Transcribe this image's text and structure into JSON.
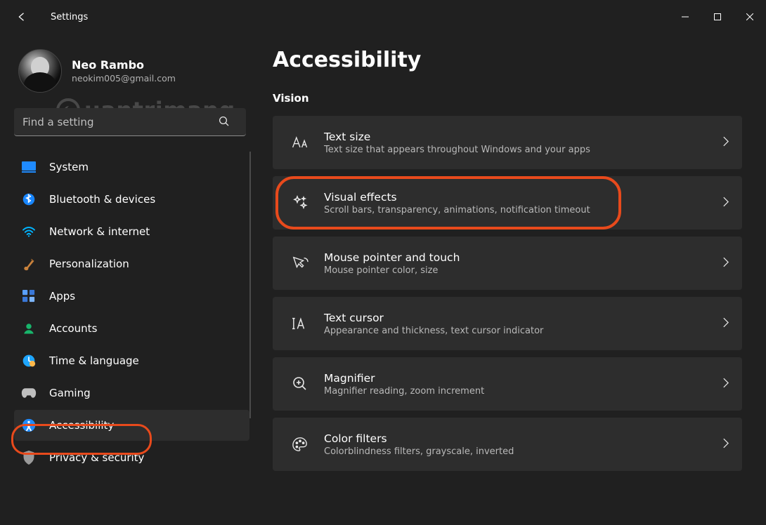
{
  "titlebar": {
    "title": "Settings"
  },
  "user": {
    "name": "Neo Rambo",
    "email": "neokim005@gmail.com"
  },
  "watermark": {
    "text": "uantrimang"
  },
  "search": {
    "placeholder": "Find a setting"
  },
  "nav": {
    "items": [
      {
        "label": "System"
      },
      {
        "label": "Bluetooth & devices"
      },
      {
        "label": "Network & internet"
      },
      {
        "label": "Personalization"
      },
      {
        "label": "Apps"
      },
      {
        "label": "Accounts"
      },
      {
        "label": "Time & language"
      },
      {
        "label": "Gaming"
      },
      {
        "label": "Accessibility"
      },
      {
        "label": "Privacy & security"
      }
    ],
    "active_index": 8
  },
  "page": {
    "title": "Accessibility",
    "section": "Vision",
    "items": [
      {
        "title": "Text size",
        "desc": "Text size that appears throughout Windows and your apps"
      },
      {
        "title": "Visual effects",
        "desc": "Scroll bars, transparency, animations, notification timeout"
      },
      {
        "title": "Mouse pointer and touch",
        "desc": "Mouse pointer color, size"
      },
      {
        "title": "Text cursor",
        "desc": "Appearance and thickness, text cursor indicator"
      },
      {
        "title": "Magnifier",
        "desc": "Magnifier reading, zoom increment"
      },
      {
        "title": "Color filters",
        "desc": "Colorblindness filters, grayscale, inverted"
      }
    ],
    "highlighted_index": 1
  },
  "annotation": {
    "sidebar_highlight": "Accessibility",
    "card_highlight": "Visual effects"
  }
}
